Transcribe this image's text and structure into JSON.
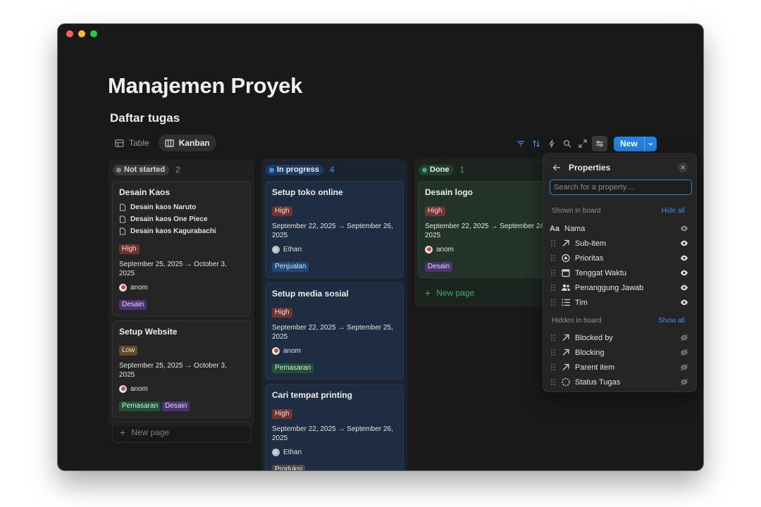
{
  "page": {
    "title": "Manajemen Proyek",
    "database_title": "Daftar tugas"
  },
  "views": [
    {
      "label": "Table",
      "icon": "table-icon",
      "active": false
    },
    {
      "label": "Kanban",
      "icon": "board-icon",
      "active": true
    }
  ],
  "toolbar": {
    "new_label": "New",
    "accent": "#2383e2"
  },
  "columns": {
    "not_started": {
      "status": "Not started",
      "count": "2",
      "cards": [
        {
          "title": "Desain Kaos",
          "sub_items": [
            "Desain kaos Naruto",
            "Desain kaos One Piece",
            "Desain kaos Kagurabachi"
          ],
          "priority": "High",
          "date": "September 25, 2025 → October 3, 2025",
          "assignee": "anom",
          "teams": [
            "Desain"
          ]
        },
        {
          "title": "Setup Website",
          "priority": "Low",
          "date": "September 25, 2025 → October 3, 2025",
          "assignee": "anom",
          "teams": [
            "Pemasaran",
            "Desain"
          ]
        }
      ],
      "new_page": "New page"
    },
    "in_progress": {
      "status": "In progress",
      "count": "4",
      "cards": [
        {
          "title": "Setup toko online",
          "priority": "High",
          "date_line1": "September 22, 2025 → September 26,",
          "date_line2": "2025",
          "assignee": "Ethan",
          "team": "Penjualan"
        },
        {
          "title": "Setup media sosial",
          "priority": "High",
          "date_line1": "September 22, 2025 → September 25,",
          "date_line2": "2025",
          "assignee": "anom",
          "team": "Pemasaran"
        },
        {
          "title": "Cari tempat printing",
          "priority": "High",
          "date_line1": "September 22, 2025 → September 26,",
          "date_line2": "2025",
          "assignee": "Ethan",
          "team": "Produksi"
        }
      ]
    },
    "done": {
      "status": "Done",
      "count": "1",
      "cards": [
        {
          "title": "Desain logo",
          "priority": "High",
          "date_line1": "September 22, 2025 → September 24,",
          "date_line2": "2025",
          "assignee": "anom",
          "team": "Desain"
        }
      ],
      "new_page": "New page"
    }
  },
  "properties_panel": {
    "title": "Properties",
    "search_placeholder": "Search for a property…",
    "shown_label": "Shown in board",
    "hide_all": "Hide all",
    "hidden_label": "Hidden in board",
    "show_all": "Show all",
    "shown": [
      {
        "label": "Nama",
        "icon": "title-aa-icon"
      },
      {
        "label": "Sub-item",
        "icon": "relation-arrow-icon"
      },
      {
        "label": "Prioritas",
        "icon": "status-circle-icon"
      },
      {
        "label": "Tenggat Waktu",
        "icon": "calendar-icon"
      },
      {
        "label": "Penanggung Jawab",
        "icon": "people-icon"
      },
      {
        "label": "Tim",
        "icon": "list-icon"
      }
    ],
    "hidden": [
      {
        "label": "Blocked by",
        "icon": "relation-arrow-icon"
      },
      {
        "label": "Blocking",
        "icon": "relation-arrow-icon"
      },
      {
        "label": "Parent item",
        "icon": "relation-arrow-icon"
      },
      {
        "label": "Status Tugas",
        "icon": "status-dashed-icon"
      }
    ]
  }
}
